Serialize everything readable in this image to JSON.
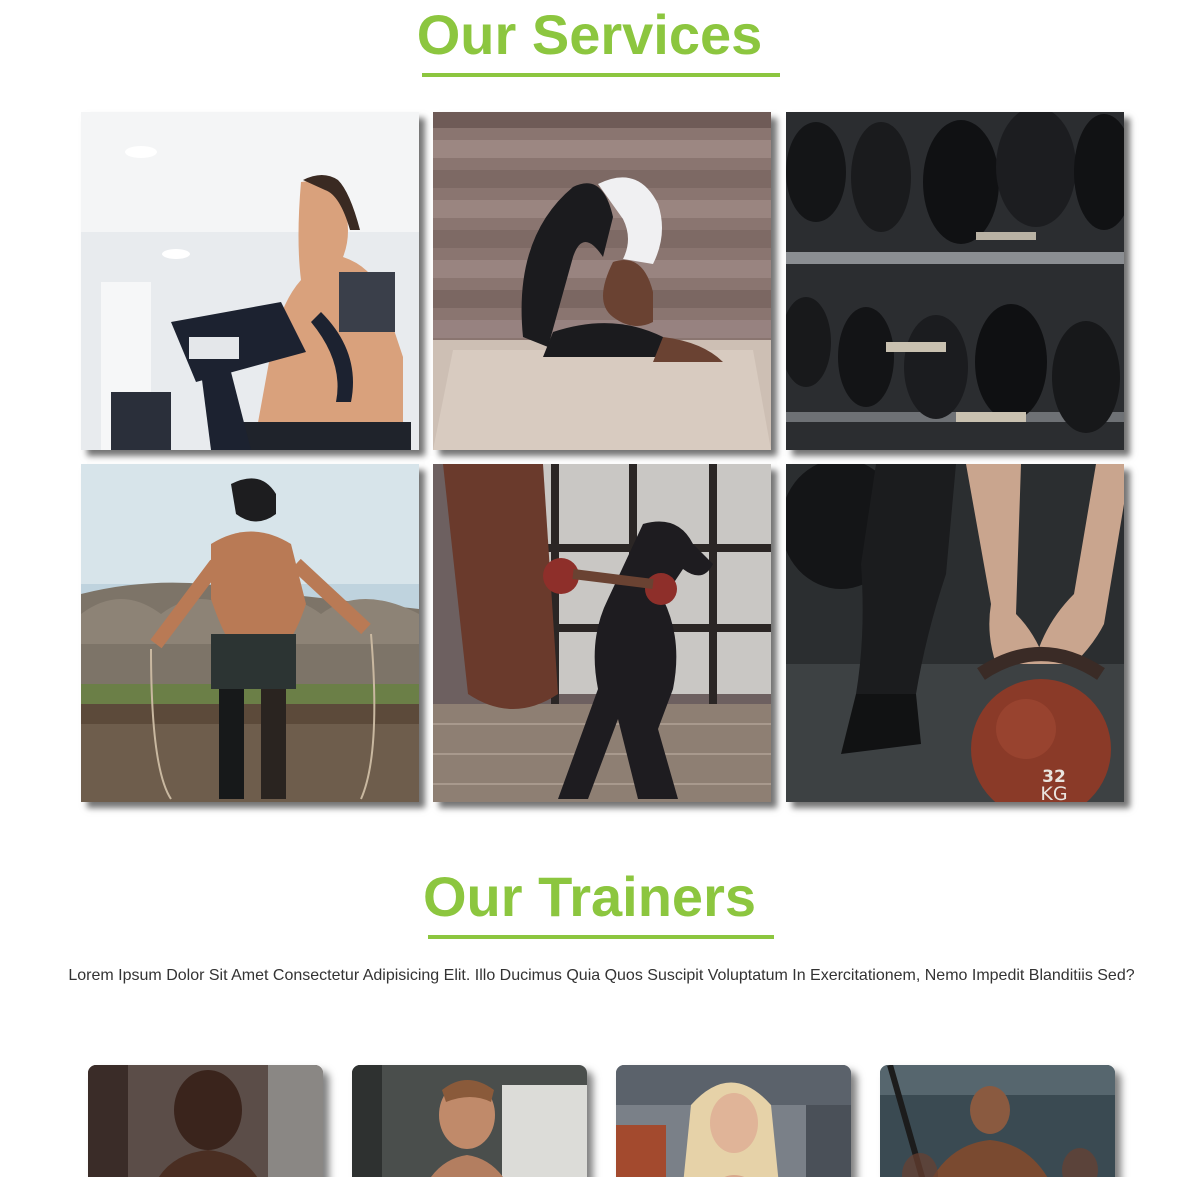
{
  "services": {
    "title": "Our Services",
    "tiles": [
      {
        "image": "woman-on-elliptical-trainer"
      },
      {
        "image": "woman-yoga-backbend-pose"
      },
      {
        "image": "dumbbell-rack"
      },
      {
        "image": "man-jump-rope-by-river"
      },
      {
        "image": "woman-boxing-punching-bag"
      },
      {
        "image": "hands-lifting-kettlebell"
      }
    ],
    "kettlebell_marking": [
      "32",
      "KG"
    ]
  },
  "trainers": {
    "title": "Our Trainers",
    "description": "Lorem Ipsum Dolor Sit Amet Consectetur Adipisicing Elit. Illo Ducimus Quia Quos Suscipit Voluptatum In Exercitationem, Nemo Impedit Blanditiis Sed?",
    "cards": [
      {
        "image": "trainer-portrait-bald-man"
      },
      {
        "image": "trainer-portrait-bearded-man"
      },
      {
        "image": "trainer-portrait-blonde-woman"
      },
      {
        "image": "trainer-portrait-bodybuilder"
      }
    ]
  },
  "colors": {
    "accent": "#8cc63f",
    "text": "#333333",
    "background": "#ffffff"
  }
}
